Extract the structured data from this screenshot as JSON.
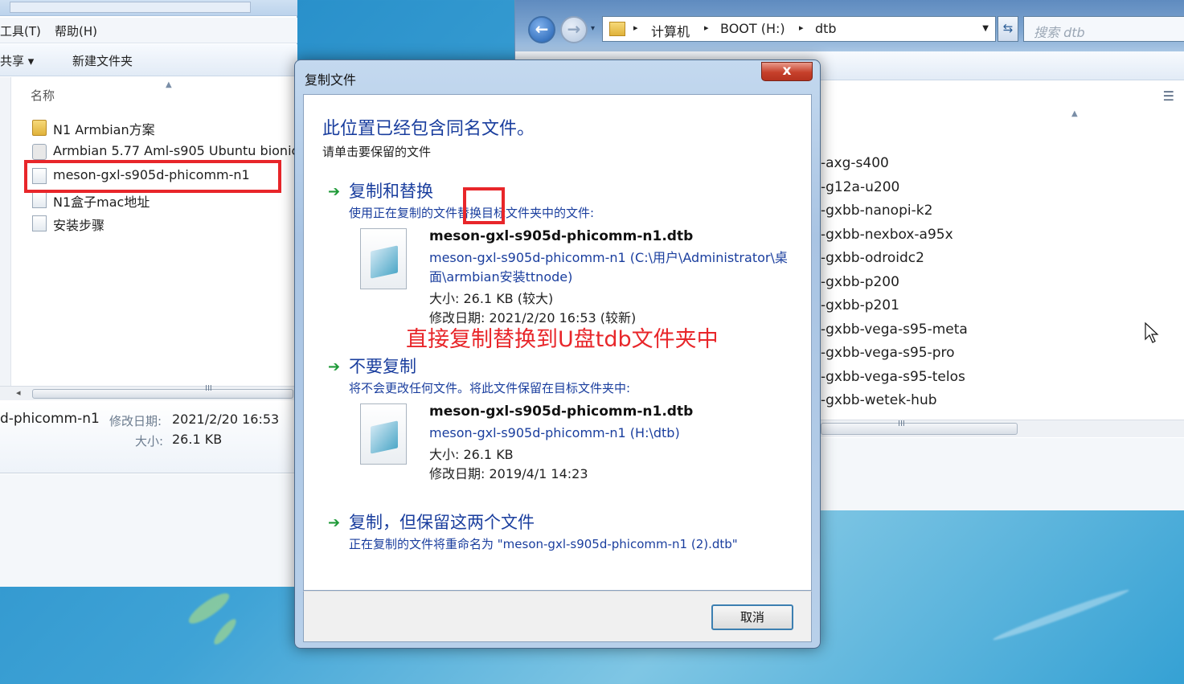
{
  "left_window": {
    "menu": {
      "tools": "工具(T)",
      "help": "帮助(H)"
    },
    "toolbar": {
      "share": "共享 ▾",
      "new_folder": "新建文件夹"
    },
    "column_header": "名称",
    "files": [
      {
        "name": "N1 Armbian方案",
        "icon": "folder-icon"
      },
      {
        "name": "Armbian 5.77 Aml-s905 Ubuntu bionic",
        "icon": "installer-icon"
      },
      {
        "name": "meson-gxl-s905d-phicomm-n1",
        "icon": "dtb-file-icon"
      },
      {
        "name": "N1盒子mac地址",
        "icon": "text-file-icon"
      },
      {
        "name": "安装步骤",
        "icon": "text-file-icon"
      }
    ],
    "details": {
      "name": "d-phicomm-n1",
      "modified_label": "修改日期:",
      "modified_value": "2021/2/20 16:53",
      "size_label": "大小:",
      "size_value": "26.1 KB"
    },
    "scroll_grip": "III"
  },
  "right_window": {
    "breadcrumb": [
      "计算机",
      "BOOT (H:)",
      "dtb"
    ],
    "search_placeholder": "搜索 dtb",
    "files": [
      "-axg-s400",
      "-g12a-u200",
      "-gxbb-nanopi-k2",
      "-gxbb-nexbox-a95x",
      "-gxbb-odroidc2",
      "-gxbb-p200",
      "-gxbb-p201",
      "-gxbb-vega-s95-meta",
      "-gxbb-vega-s95-pro",
      "-gxbb-vega-s95-telos",
      "-gxbb-wetek-hub"
    ],
    "scroll_grip": "III"
  },
  "dialog": {
    "title": "复制文件",
    "close_label": "x",
    "main_instruction": "此位置已经包含同名文件。",
    "sub_instruction": "请单击要保留的文件",
    "options": [
      {
        "title": "复制和替换",
        "description": "使用正在复制的文件替换目标文件夹中的文件:",
        "file": {
          "name": "meson-gxl-s905d-phicomm-n1.dtb",
          "path": "meson-gxl-s905d-phicomm-n1 (C:\\用户\\Administrator\\桌面\\armbian安装ttnode)",
          "size": "大小: 26.1 KB (较大)",
          "modified": "修改日期: 2021/2/20 16:53 (较新)"
        }
      },
      {
        "title": "不要复制",
        "description": "将不会更改任何文件。将此文件保留在目标文件夹中:",
        "file": {
          "name": "meson-gxl-s905d-phicomm-n1.dtb",
          "path": "meson-gxl-s905d-phicomm-n1 (H:\\dtb)",
          "size": "大小: 26.1 KB",
          "modified": "修改日期: 2019/4/1 14:23"
        }
      },
      {
        "title": "复制，但保留这两个文件",
        "description": "正在复制的文件将重命名为 \"meson-gxl-s905d-phicomm-n1 (2).dtb\""
      }
    ],
    "cancel_label": "取消"
  },
  "annotation_text": "直接复制替换到U盘tdb文件夹中",
  "colors": {
    "highlight_red": "#e8262a",
    "link_blue": "#1a3e9e",
    "arrow_green": "#1f9a38"
  }
}
